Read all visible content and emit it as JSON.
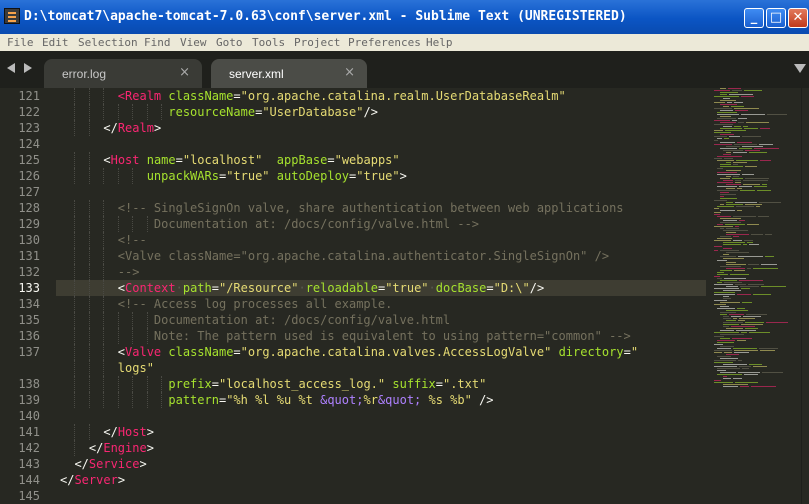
{
  "window": {
    "title": "D:\\tomcat7\\apache-tomcat-7.0.63\\conf\\server.xml - Sublime Text (UNREGISTERED)",
    "controls": {
      "minimize": "_",
      "maximize": "□",
      "close": "✕"
    }
  },
  "menu": [
    "File",
    "Edit",
    "Selection",
    "Find",
    "View",
    "Goto",
    "Tools",
    "Project",
    "Preferences",
    "Help"
  ],
  "tabs": [
    {
      "label": "error.log",
      "active": false,
      "close": "×"
    },
    {
      "label": "server.xml",
      "active": true,
      "close": "×"
    }
  ],
  "editor": {
    "active_line": "133",
    "lines": [
      {
        "num": "121",
        "indent": 8,
        "tokens": [
          [
            "tag",
            "<Realm "
          ],
          [
            "attr",
            "className"
          ],
          [
            "plain",
            "="
          ],
          [
            "str",
            "\"org.apache.catalina.realm.UserDatabaseRealm\""
          ]
        ]
      },
      {
        "num": "122",
        "indent": 15,
        "tokens": [
          [
            "attr",
            "resourceName"
          ],
          [
            "plain",
            "="
          ],
          [
            "str",
            "\"UserDatabase\""
          ],
          [
            "plain",
            "/>"
          ]
        ]
      },
      {
        "num": "123",
        "indent": 6,
        "tokens": [
          [
            "plain",
            "</"
          ],
          [
            "tag",
            "Realm"
          ],
          [
            "plain",
            ">"
          ]
        ]
      },
      {
        "num": "124",
        "indent": 0,
        "tokens": []
      },
      {
        "num": "125",
        "indent": 6,
        "tokens": [
          [
            "plain",
            "<"
          ],
          [
            "tag",
            "Host "
          ],
          [
            "attr",
            "name"
          ],
          [
            "plain",
            "="
          ],
          [
            "str",
            "\"localhost\""
          ],
          [
            "plain",
            "  "
          ],
          [
            "attr",
            "appBase"
          ],
          [
            "plain",
            "="
          ],
          [
            "str",
            "\"webapps\""
          ]
        ]
      },
      {
        "num": "126",
        "indent": 12,
        "tokens": [
          [
            "attr",
            "unpackWARs"
          ],
          [
            "plain",
            "="
          ],
          [
            "str",
            "\"true\""
          ],
          [
            "plain",
            " "
          ],
          [
            "attr",
            "autoDeploy"
          ],
          [
            "plain",
            "="
          ],
          [
            "str",
            "\"true\""
          ],
          [
            "plain",
            ">"
          ]
        ]
      },
      {
        "num": "127",
        "indent": 0,
        "tokens": []
      },
      {
        "num": "128",
        "indent": 8,
        "tokens": [
          [
            "cmt",
            "<!-- SingleSignOn valve, share authentication between web applications"
          ]
        ]
      },
      {
        "num": "129",
        "indent": 13,
        "tokens": [
          [
            "cmt",
            "Documentation at: /docs/config/valve.html -->"
          ]
        ]
      },
      {
        "num": "130",
        "indent": 8,
        "tokens": [
          [
            "cmt",
            "<!--"
          ]
        ]
      },
      {
        "num": "131",
        "indent": 8,
        "tokens": [
          [
            "cmt",
            "<Valve className=\"org.apache.catalina.authenticator.SingleSignOn\" />"
          ]
        ]
      },
      {
        "num": "132",
        "indent": 8,
        "tokens": [
          [
            "cmt",
            "-->"
          ]
        ]
      },
      {
        "num": "133",
        "indent": 8,
        "tokens": [
          [
            "plain",
            "<"
          ],
          [
            "tag",
            "Context"
          ],
          [
            "ws",
            "·"
          ],
          [
            "attr",
            "path"
          ],
          [
            "plain",
            "="
          ],
          [
            "str",
            "\"/Resource\""
          ],
          [
            "ws",
            "·"
          ],
          [
            "attr",
            "reloadable"
          ],
          [
            "plain",
            "="
          ],
          [
            "str",
            "\"true\""
          ],
          [
            "ws",
            "·"
          ],
          [
            "attr",
            "docBase"
          ],
          [
            "plain",
            "="
          ],
          [
            "str",
            "\"D:\\\""
          ],
          [
            "plain",
            "/>"
          ]
        ]
      },
      {
        "num": "134",
        "indent": 8,
        "tokens": [
          [
            "cmt",
            "<!-- Access log processes all example."
          ]
        ]
      },
      {
        "num": "135",
        "indent": 13,
        "tokens": [
          [
            "cmt",
            "Documentation at: /docs/config/valve.html"
          ]
        ]
      },
      {
        "num": "136",
        "indent": 13,
        "tokens": [
          [
            "cmt",
            "Note: The pattern used is equivalent to using pattern=\"common\" -->"
          ]
        ]
      },
      {
        "num": "137",
        "indent": 8,
        "tokens": [
          [
            "plain",
            "<"
          ],
          [
            "tag",
            "Valve "
          ],
          [
            "attr",
            "className"
          ],
          [
            "plain",
            "="
          ],
          [
            "str",
            "\"org.apache.catalina.valves.AccessLogValve\""
          ],
          [
            "plain",
            " "
          ],
          [
            "attr",
            "directory"
          ],
          [
            "plain",
            "="
          ],
          [
            "str",
            "\""
          ]
        ]
      },
      {
        "num": "",
        "indent": 8,
        "tokens": [
          [
            "str",
            "logs\""
          ]
        ]
      },
      {
        "num": "138",
        "indent": 15,
        "tokens": [
          [
            "attr",
            "prefix"
          ],
          [
            "plain",
            "="
          ],
          [
            "str",
            "\"localhost_access_log.\""
          ],
          [
            "plain",
            " "
          ],
          [
            "attr",
            "suffix"
          ],
          [
            "plain",
            "="
          ],
          [
            "str",
            "\".txt\""
          ]
        ]
      },
      {
        "num": "139",
        "indent": 15,
        "tokens": [
          [
            "attr",
            "pattern"
          ],
          [
            "plain",
            "="
          ],
          [
            "str",
            "\"%h %l %u %t "
          ],
          [
            "ent",
            "&quot;"
          ],
          [
            "str",
            "%r"
          ],
          [
            "ent",
            "&quot;"
          ],
          [
            "str",
            " %s %b\""
          ],
          [
            "plain",
            " />"
          ]
        ]
      },
      {
        "num": "140",
        "indent": 0,
        "tokens": []
      },
      {
        "num": "141",
        "indent": 6,
        "tokens": [
          [
            "plain",
            "</"
          ],
          [
            "tag",
            "Host"
          ],
          [
            "plain",
            ">"
          ]
        ]
      },
      {
        "num": "142",
        "indent": 4,
        "tokens": [
          [
            "plain",
            "</"
          ],
          [
            "tag",
            "Engine"
          ],
          [
            "plain",
            ">"
          ]
        ]
      },
      {
        "num": "143",
        "indent": 2,
        "tokens": [
          [
            "plain",
            "</"
          ],
          [
            "tag",
            "Service"
          ],
          [
            "plain",
            ">"
          ]
        ]
      },
      {
        "num": "144",
        "indent": 0,
        "tokens": [
          [
            "plain",
            "</"
          ],
          [
            "tag",
            "Server"
          ],
          [
            "plain",
            ">"
          ]
        ]
      },
      {
        "num": "145",
        "indent": 0,
        "tokens": []
      }
    ]
  },
  "colors": {
    "tag": "#f92672",
    "attr": "#a6e22e",
    "string": "#e6db74",
    "comment": "#75715e",
    "entity": "#ae81ff",
    "background": "#272822",
    "title_bar": "#0b55c4"
  }
}
